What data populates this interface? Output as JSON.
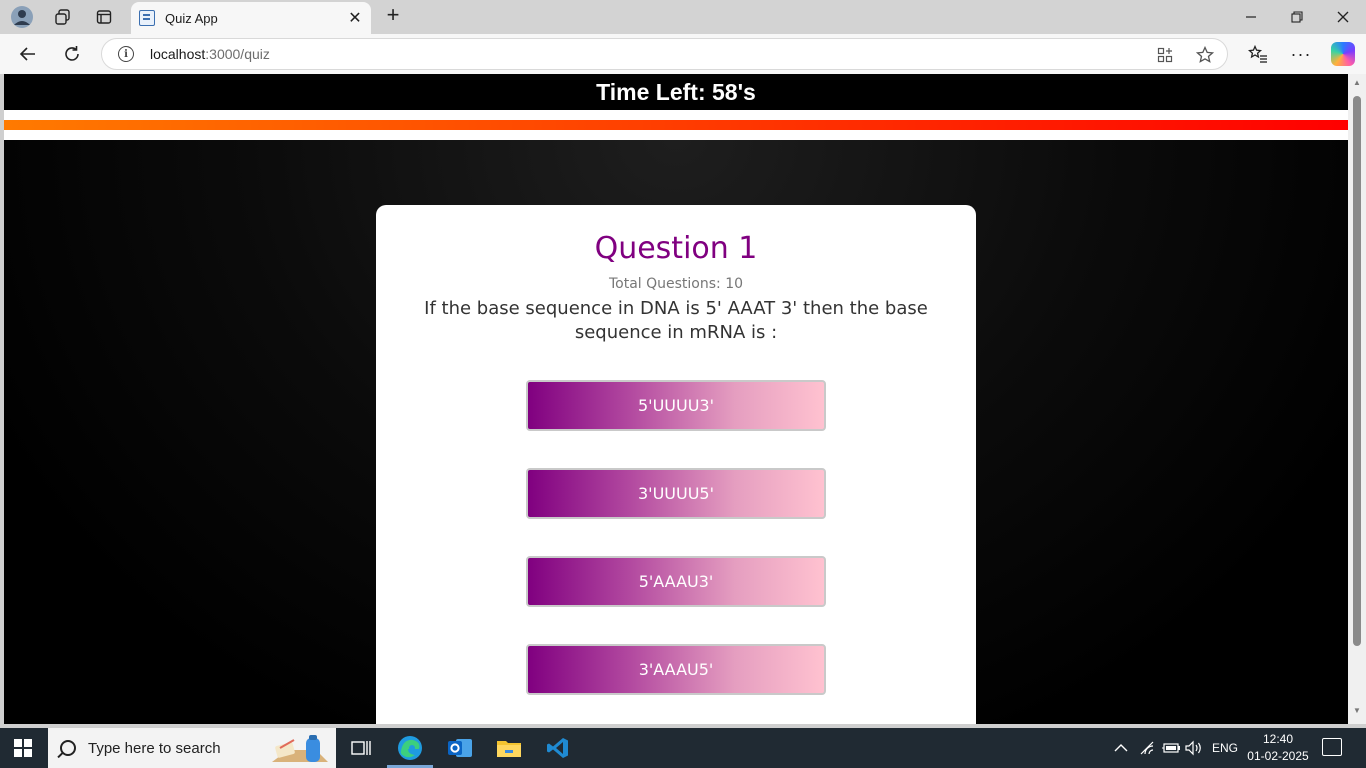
{
  "browser": {
    "tab_title": "Quiz App",
    "url_host": "localhost",
    "url_path": ":3000/quiz"
  },
  "quiz": {
    "timer_text": "Time Left: 58's",
    "time_progress_fraction": 1.0,
    "question_title": "Question 1",
    "total_questions": "Total Questions: 10",
    "question_text": "If the base sequence in DNA is 5' AAAT 3' then the base sequence in mRNA is :",
    "options": [
      "5'UUUU3'",
      "3'UUUU5'",
      "5'AAAU3'",
      "3'AAAU5'"
    ]
  },
  "taskbar": {
    "search_placeholder": "Type here to search",
    "language": "ENG",
    "time": "12:40",
    "date": "01-02-2025"
  },
  "colors": {
    "question_title": "#800080",
    "option_gradient_start": "#800080",
    "option_gradient_end": "#ffc2d0",
    "progress_start": "#ff7a00",
    "progress_end": "#ff0000"
  },
  "icons": [
    "profile-avatar-icon",
    "workspaces-icon",
    "tab-actions-icon",
    "back-icon",
    "refresh-icon",
    "info-icon",
    "app-available-icon",
    "favorite-star-icon",
    "favorites-list-icon",
    "more-icon",
    "copilot-icon",
    "windows-start-icon",
    "search-icon",
    "task-view-icon",
    "edge-icon",
    "outlook-icon",
    "file-explorer-icon",
    "vscode-icon",
    "chevron-up-icon",
    "network-icon",
    "battery-icon",
    "volume-icon",
    "notification-icon"
  ]
}
